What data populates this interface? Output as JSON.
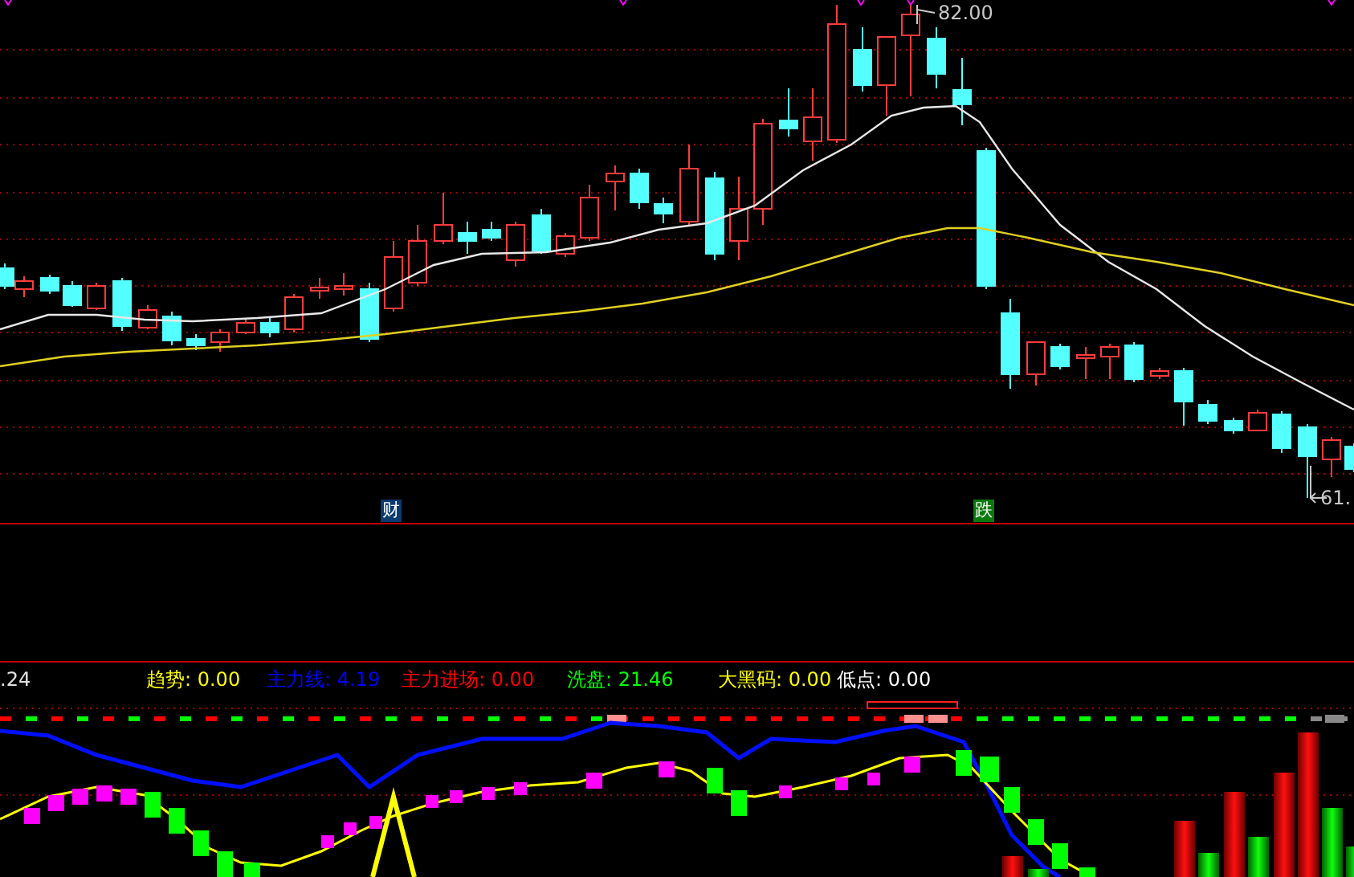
{
  "price_labels": [
    {
      "kind": "high",
      "text": "82.00"
    },
    {
      "kind": "low",
      "text": "61."
    }
  ],
  "signal_marks": [
    {
      "text": "财",
      "color": "#0b3a6e"
    },
    {
      "text": "跌",
      "color": "#0a7a0a"
    }
  ],
  "indicator_panel": {
    "cut_value": ".24",
    "readouts": [
      {
        "label": "趋势: 0.00",
        "color": "#ffff00"
      },
      {
        "label": "主力线: 4.19",
        "color": "#0000ff"
      },
      {
        "label": "主力进场: 0.00",
        "color": "#ff0000"
      },
      {
        "label": "洗盘: 21.46",
        "color": "#00ff00"
      },
      {
        "label": "大黑码: 0.00",
        "color": "#ffff00"
      },
      {
        "label": "低点: 0.00",
        "color": "#ffffff"
      }
    ]
  }
}
